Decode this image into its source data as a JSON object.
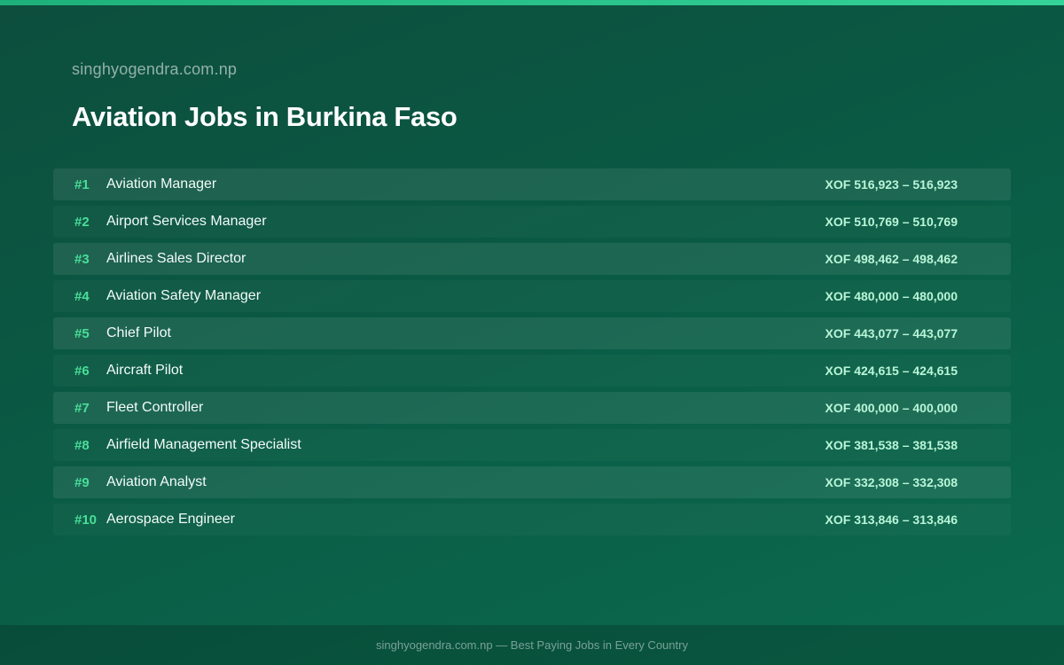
{
  "site": "singhyogendra.com.np",
  "title": "Aviation Jobs in Burkina Faso",
  "jobs": [
    {
      "rank": "#1",
      "title": "Aviation Manager",
      "salary": "XOF 516,923 – 516,923"
    },
    {
      "rank": "#2",
      "title": "Airport Services Manager",
      "salary": "XOF 510,769 – 510,769"
    },
    {
      "rank": "#3",
      "title": "Airlines Sales Director",
      "salary": "XOF 498,462 – 498,462"
    },
    {
      "rank": "#4",
      "title": "Aviation Safety Manager",
      "salary": "XOF 480,000 – 480,000"
    },
    {
      "rank": "#5",
      "title": "Chief Pilot",
      "salary": "XOF 443,077 – 443,077"
    },
    {
      "rank": "#6",
      "title": "Aircraft Pilot",
      "salary": "XOF 424,615 – 424,615"
    },
    {
      "rank": "#7",
      "title": "Fleet Controller",
      "salary": "XOF 400,000 – 400,000"
    },
    {
      "rank": "#8",
      "title": "Airfield Management Specialist",
      "salary": "XOF 381,538 – 381,538"
    },
    {
      "rank": "#9",
      "title": "Aviation Analyst",
      "salary": "XOF 332,308 – 332,308"
    },
    {
      "rank": "#10",
      "title": "Aerospace Engineer",
      "salary": "XOF 313,846 – 313,846"
    }
  ],
  "footer": "singhyogendra.com.np — Best Paying Jobs in Every Country",
  "colors": {
    "accent": "#34d399",
    "rank": "#4ade9a",
    "salary": "#b9f5d8",
    "background": "#0a5a44"
  }
}
